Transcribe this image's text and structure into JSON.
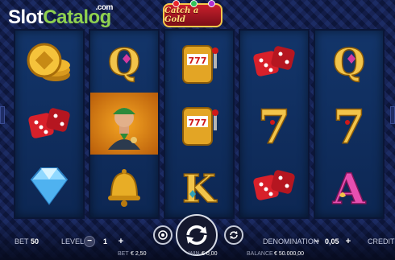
{
  "brand": {
    "slot": "Slot",
    "catalog": "Catalog",
    "com": ".com"
  },
  "game": {
    "title": "Catch a Gold"
  },
  "reels": [
    [
      "gold-coin-stack-icon",
      "red-dice-icon",
      "diamond-icon"
    ],
    [
      "gold-q-icon",
      "character-man-icon",
      "gold-bell-icon"
    ],
    [
      "slot-machine-icon",
      "slot-machine-icon",
      "gold-k-icon"
    ],
    [
      "red-dice-icon",
      "gold-seven-icon",
      "red-dice-icon"
    ],
    [
      "gold-q-icon",
      "gold-seven-icon",
      "gold-a-icon"
    ]
  ],
  "controls": {
    "bet_label": "BET",
    "bet_value": "50",
    "level_label": "LEVEL",
    "level_value": "1",
    "minus": "−",
    "plus": "+",
    "denomination_label": "DENOMINATION",
    "denomination_value": "0,05",
    "credits_label": "CREDITS"
  },
  "footer": {
    "bet_label": "BET",
    "bet_value": "€ 2,50",
    "win_label": "WIN",
    "win_value": "€ 0,00",
    "balance_label": "BALANCE",
    "balance_value": "€ 50.000,00"
  }
}
